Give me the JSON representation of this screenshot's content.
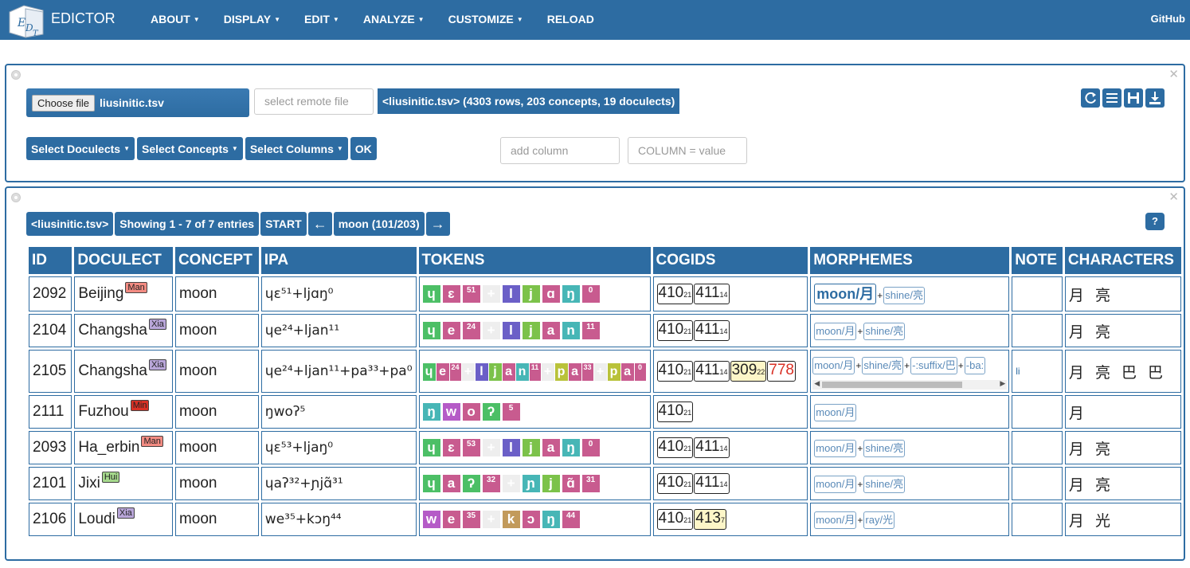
{
  "nav": {
    "brand": "EDICTOR",
    "items": [
      "ABOUT",
      "DISPLAY",
      "EDIT",
      "ANALYZE",
      "CUSTOMIZE",
      "RELOAD"
    ],
    "github": "GitHub"
  },
  "top_panel": {
    "choose_label": "Choose file",
    "file_name": "liusinitic.tsv",
    "remote_placeholder": "select remote file",
    "file_info": "<liusinitic.tsv> (4303 rows, 203 concepts, 19 doculects)",
    "select_doculects": "Select Doculects",
    "select_concepts": "Select Concepts",
    "select_columns": "Select Columns",
    "ok": "OK",
    "add_column_placeholder": "add column",
    "column_value_placeholder": "COLUMN = value"
  },
  "main_panel": {
    "file_button": "<liusinitic.tsv>",
    "showing": "Showing 1 - 7 of 7 entries",
    "start": "START",
    "prev": "←",
    "concept_nav": "moon (101/203)",
    "next": "→",
    "help": "?"
  },
  "table": {
    "headers": [
      "ID",
      "DOCULECT",
      "CONCEPT",
      "IPA",
      "TOKENS",
      "COGIDS",
      "MORPHEMES",
      "NOTE",
      "CHARACTERS"
    ],
    "rows": [
      {
        "id": "2092",
        "doculect": "Beijing",
        "tag": "Man",
        "tag_color": "#f28b82",
        "concept": "moon",
        "ipa": "ɥɛ⁵¹+ljɑŋ⁰",
        "note": "",
        "chars": "月 亮"
      },
      {
        "id": "2104",
        "doculect": "Changsha",
        "tag": "Xia",
        "tag_color": "#b9a6d9",
        "concept": "moon",
        "ipa": "ɥe²⁴+ljan¹¹",
        "note": "",
        "chars": "月 亮"
      },
      {
        "id": "2105",
        "doculect": "Changsha",
        "tag": "Xia",
        "tag_color": "#b9a6d9",
        "concept": "moon",
        "ipa": "ɥe²⁴+ljan¹¹+pa³³+pa⁰",
        "note": "li",
        "chars": "月 亮 巴 巴"
      },
      {
        "id": "2111",
        "doculect": "Fuzhou",
        "tag": "Min",
        "tag_color": "#d93025",
        "concept": "moon",
        "ipa": "ŋwoʔ⁵",
        "note": "",
        "chars": "月"
      },
      {
        "id": "2093",
        "doculect": "Ha_erbin",
        "tag": "Man",
        "tag_color": "#f28b82",
        "concept": "moon",
        "ipa": "ɥɛ⁵³+ljaŋ⁰",
        "note": "",
        "chars": "月 亮"
      },
      {
        "id": "2101",
        "doculect": "Jixi",
        "tag": "Hui",
        "tag_color": "#a5d88c",
        "concept": "moon",
        "ipa": "ɥaʔ³²+ɲjɑ̃³¹",
        "note": "",
        "chars": "月 亮"
      },
      {
        "id": "2106",
        "doculect": "Loudi",
        "tag": "Xia",
        "tag_color": "#b9a6d9",
        "concept": "moon",
        "ipa": "we³⁵+kɔŋ⁴⁴",
        "note": "",
        "chars": "月 光"
      }
    ],
    "tokens": [
      [
        [
          "ɥ",
          "#4cbf66",
          0
        ],
        [
          "ɛ",
          "#c85b8f",
          0
        ],
        [
          "51",
          "#c85b8f",
          1
        ],
        [
          "+",
          "#eeeeee",
          2
        ],
        [
          "l",
          "#6b5fc7",
          0
        ],
        [
          "j",
          "#7cc24a",
          0
        ],
        [
          "ɑ",
          "#c85b8f",
          0
        ],
        [
          "ŋ",
          "#47b6b6",
          0
        ],
        [
          "0",
          "#c85b8f",
          1
        ]
      ],
      [
        [
          "ɥ",
          "#4cbf66",
          0
        ],
        [
          "e",
          "#c85b8f",
          0
        ],
        [
          "24",
          "#c85b8f",
          1
        ],
        [
          "+",
          "#eeeeee",
          2
        ],
        [
          "l",
          "#6b5fc7",
          0
        ],
        [
          "j",
          "#7cc24a",
          0
        ],
        [
          "a",
          "#c85b8f",
          0
        ],
        [
          "n",
          "#47b6b6",
          0
        ],
        [
          "11",
          "#c85b8f",
          1
        ]
      ],
      [
        [
          "ɥ",
          "#4cbf66",
          0
        ],
        [
          "e",
          "#c85b8f",
          0
        ],
        [
          "24",
          "#c85b8f",
          1
        ],
        [
          "+",
          "#eeeeee",
          2
        ],
        [
          "l",
          "#6b5fc7",
          0
        ],
        [
          "j",
          "#7cc24a",
          0
        ],
        [
          "a",
          "#c85b8f",
          0
        ],
        [
          "n",
          "#47b6b6",
          0
        ],
        [
          "11",
          "#c85b8f",
          1
        ],
        [
          "+",
          "#eeeeee",
          2
        ],
        [
          "p",
          "#b9c23a",
          0
        ],
        [
          "a",
          "#c85b8f",
          0
        ],
        [
          "33",
          "#c85b8f",
          1
        ],
        [
          "+",
          "#eeeeee",
          2
        ],
        [
          "p",
          "#b9c23a",
          0
        ],
        [
          "a",
          "#c85b8f",
          0
        ],
        [
          "0",
          "#c85b8f",
          1
        ]
      ],
      [
        [
          "ŋ",
          "#47b6b6",
          0
        ],
        [
          "w",
          "#b55bc7",
          0
        ],
        [
          "o",
          "#c85b8f",
          0
        ],
        [
          "ʔ",
          "#4cbf66",
          0
        ],
        [
          "5",
          "#c85b8f",
          1
        ]
      ],
      [
        [
          "ɥ",
          "#4cbf66",
          0
        ],
        [
          "ɛ",
          "#c85b8f",
          0
        ],
        [
          "53",
          "#c85b8f",
          1
        ],
        [
          "+",
          "#eeeeee",
          2
        ],
        [
          "l",
          "#6b5fc7",
          0
        ],
        [
          "j",
          "#7cc24a",
          0
        ],
        [
          "a",
          "#c85b8f",
          0
        ],
        [
          "ŋ",
          "#47b6b6",
          0
        ],
        [
          "0",
          "#c85b8f",
          1
        ]
      ],
      [
        [
          "ɥ",
          "#4cbf66",
          0
        ],
        [
          "a",
          "#c85b8f",
          0
        ],
        [
          "ʔ",
          "#4cbf66",
          0
        ],
        [
          "32",
          "#c85b8f",
          1
        ],
        [
          "+",
          "#eeeeee",
          2
        ],
        [
          "ɲ",
          "#47b6b6",
          0
        ],
        [
          "j",
          "#7cc24a",
          0
        ],
        [
          "ɑ̃",
          "#c85b8f",
          0
        ],
        [
          "31",
          "#c85b8f",
          1
        ]
      ],
      [
        [
          "w",
          "#b55bc7",
          0
        ],
        [
          "e",
          "#c85b8f",
          0
        ],
        [
          "35",
          "#c85b8f",
          1
        ],
        [
          "+",
          "#eeeeee",
          2
        ],
        [
          "k",
          "#c29a5b",
          0
        ],
        [
          "ɔ",
          "#c85b8f",
          0
        ],
        [
          "ŋ",
          "#47b6b6",
          0
        ],
        [
          "44",
          "#c85b8f",
          1
        ]
      ]
    ],
    "cogids": [
      [
        [
          "410",
          "21",
          "#fff"
        ],
        [
          "411",
          "14",
          "#fff"
        ]
      ],
      [
        [
          "410",
          "21",
          "#fff"
        ],
        [
          "411",
          "14",
          "#fff"
        ]
      ],
      [
        [
          "410",
          "21",
          "#fff"
        ],
        [
          "411",
          "14",
          "#fff"
        ],
        [
          "309",
          "22",
          "#fdf6c8"
        ],
        [
          "778",
          "",
          "#fff"
        ]
      ],
      [
        [
          "410",
          "21",
          "#fff"
        ]
      ],
      [
        [
          "410",
          "21",
          "#fff"
        ],
        [
          "411",
          "14",
          "#fff"
        ]
      ],
      [
        [
          "410",
          "21",
          "#fff"
        ],
        [
          "411",
          "14",
          "#fff"
        ]
      ],
      [
        [
          "410",
          "21",
          "#fff"
        ],
        [
          "413",
          "7",
          "#fdf6c8"
        ]
      ]
    ],
    "morphemes": [
      [
        "moon/月",
        "shine/亮"
      ],
      [
        "moon/月",
        "shine/亮"
      ],
      [
        "moon/月",
        "shine/亮",
        "-:suffix/巴",
        "-ba:"
      ],
      [
        "moon/月"
      ],
      [
        "moon/月",
        "shine/亮"
      ],
      [
        "moon/月",
        "shine/亮"
      ],
      [
        "moon/月",
        "ray/光"
      ]
    ]
  },
  "colors": {
    "primary": "#2d6ca2",
    "cogid_red": "#d93025"
  }
}
